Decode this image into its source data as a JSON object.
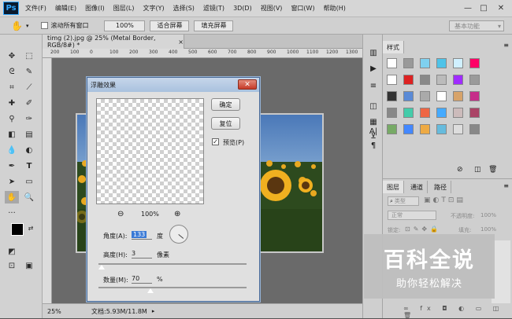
{
  "app": {
    "logo": "Ps"
  },
  "menu": [
    "文件(F)",
    "编辑(E)",
    "图像(I)",
    "图层(L)",
    "文字(Y)",
    "选择(S)",
    "滤镜(T)",
    "3D(D)",
    "视图(V)",
    "窗口(W)",
    "帮助(H)"
  ],
  "window_controls": {
    "minimize": "—",
    "maximize": "□",
    "close": "✕"
  },
  "options": {
    "scroll_all_label": "滚动所有窗口",
    "zoom_value": "100%",
    "fit_screen": "适合屏幕",
    "fill_screen": "填充屏幕",
    "workspace": "基本功能"
  },
  "document": {
    "tab_title": "timg (2).jpg @ 25% (Metal Border, RGB/8#) *",
    "tab_close": "×",
    "ruler_ticks": [
      "200",
      "100",
      "0",
      "100",
      "200",
      "300",
      "400",
      "500",
      "600",
      "700",
      "800",
      "900",
      "1000",
      "1100",
      "1200",
      "1300"
    ]
  },
  "status": {
    "zoom": "25%",
    "doc_info": "文档:5.93M/11.8M"
  },
  "dialog": {
    "title": "浮雕效果",
    "ok": "确定",
    "reset": "复位",
    "preview_label": "预览(P)",
    "preview_checked": true,
    "zoom_pct": "100%",
    "angle_label": "角度(A):",
    "angle_value": "133",
    "angle_unit": "度",
    "height_label": "高度(H):",
    "height_value": "3",
    "height_unit": "像素",
    "amount_label": "数量(M):",
    "amount_value": "70",
    "amount_unit": "%",
    "height_slider_fraction": 0.02,
    "amount_slider_fraction": 0.35
  },
  "styles_panel": {
    "tab": "样式"
  },
  "layers_panel": {
    "tabs": [
      "图层",
      "通道",
      "路径"
    ],
    "kind_filter": "类型",
    "blend_mode": "正常",
    "opacity_label": "不透明度:",
    "opacity_value": "100%",
    "lock_label": "锁定:",
    "fill_label": "填充:",
    "fill_value": "100%"
  },
  "watermark": {
    "title": "百科全说",
    "subtitle": "助你轻松解决"
  },
  "colors": {
    "accent": "#31a8ff",
    "dialog_border": "#4a6a96",
    "close_red": "#c63a28"
  }
}
